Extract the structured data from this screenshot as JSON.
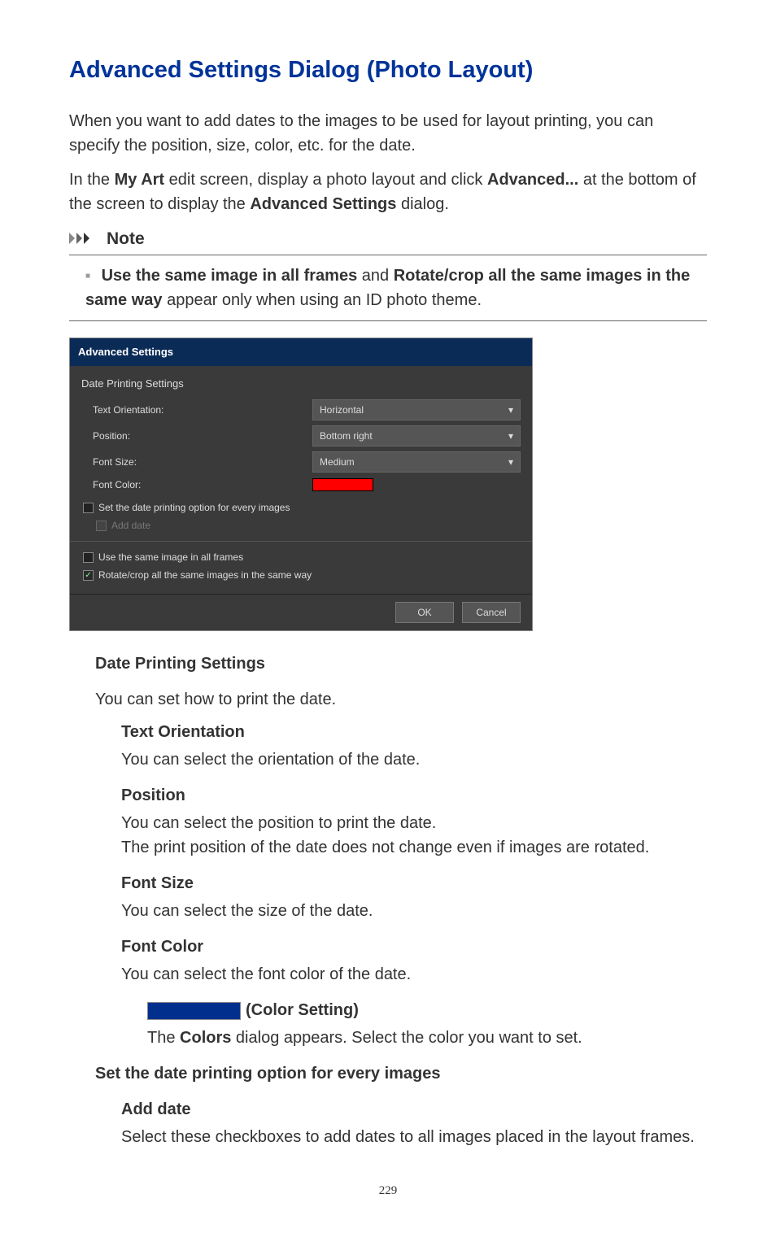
{
  "title": "Advanced Settings Dialog (Photo Layout)",
  "intro1_pre": "When you want to add dates to the images to be used for layout printing, you can specify the position, size, color, etc. for the date.",
  "intro2_a": "In the ",
  "intro2_b": "My Art",
  "intro2_c": " edit screen, display a photo layout and click ",
  "intro2_d": "Advanced...",
  "intro2_e": " at the bottom of the screen to display the ",
  "intro2_f": "Advanced Settings",
  "intro2_g": " dialog.",
  "note_label": "Note",
  "note_b1": "Use the same image in all frames",
  "note_mid": " and ",
  "note_b2": "Rotate/crop all the same images in the same way",
  "note_tail": " appear only when using an ID photo theme.",
  "dialog": {
    "title": "Advanced Settings",
    "section": "Date Printing Settings",
    "rows": {
      "text_orientation": {
        "label": "Text Orientation:",
        "value": "Horizontal"
      },
      "position": {
        "label": "Position:",
        "value": "Bottom right"
      },
      "font_size": {
        "label": "Font Size:",
        "value": "Medium"
      },
      "font_color": {
        "label": "Font Color:"
      }
    },
    "cb1": "Set the date printing option for every images",
    "cb1_sub": "Add date",
    "cb2": "Use the same image in all frames",
    "cb3": "Rotate/crop all the same images in the same way",
    "ok": "OK",
    "cancel": "Cancel"
  },
  "defs": {
    "dps": {
      "term": "Date Printing Settings",
      "desc": "You can set how to print the date."
    },
    "to": {
      "term": "Text Orientation",
      "desc": "You can select the orientation of the date."
    },
    "pos": {
      "term": "Position",
      "desc1": "You can select the position to print the date.",
      "desc2": "The print position of the date does not change even if images are rotated."
    },
    "fs": {
      "term": "Font Size",
      "desc": "You can select the size of the date."
    },
    "fc": {
      "term": "Font Color",
      "desc": "You can select the font color of the date."
    },
    "cs": {
      "term": "(Color Setting)",
      "desc_a": "The ",
      "desc_b": "Colors",
      "desc_c": " dialog appears. Select the color you want to set."
    },
    "set_opt": {
      "term": "Set the date printing option for every images"
    },
    "add_date": {
      "term": "Add date",
      "desc": "Select these checkboxes to add dates to all images placed in the layout frames."
    }
  },
  "page_number": "229"
}
